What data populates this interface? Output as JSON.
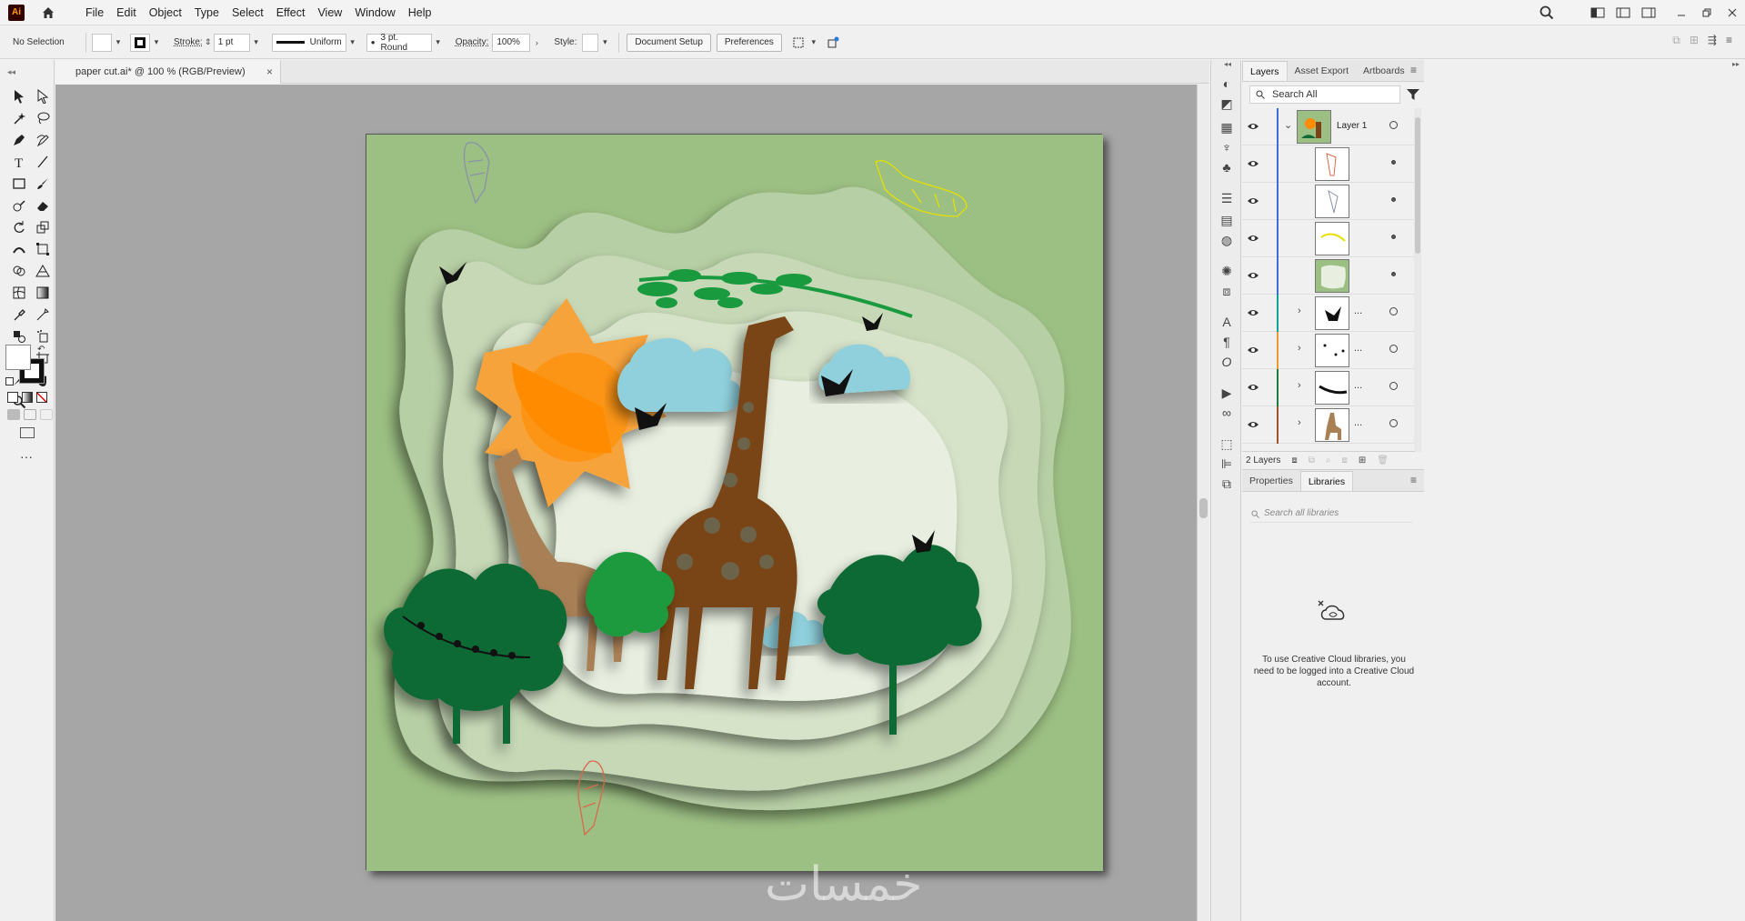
{
  "app": {
    "logo": "Ai"
  },
  "menu": {
    "items": [
      "File",
      "Edit",
      "Object",
      "Type",
      "Select",
      "Effect",
      "View",
      "Window",
      "Help"
    ]
  },
  "control_bar": {
    "selection": "No Selection",
    "stroke_label": "Stroke:",
    "stroke_value": "1 pt",
    "profile": "Uniform",
    "brush": "3 pt. Round",
    "opacity_label": "Opacity:",
    "opacity_value": "100%",
    "style_label": "Style:",
    "document_setup": "Document Setup",
    "preferences": "Preferences"
  },
  "document": {
    "tab_title": "paper cut.ai* @ 100 % (RGB/Preview)",
    "close": "×"
  },
  "layers_panel": {
    "tabs": [
      "Layers",
      "Asset Export",
      "Artboards"
    ],
    "search_placeholder": "Search All",
    "layer_name": "Layer 1",
    "footer_count": "2 Layers",
    "dots": "...",
    "row_colors": [
      "#3d6bd9",
      "#3d6bd9",
      "#3d6bd9",
      "#3d6bd9",
      "#3d6bd9",
      "#0fa19a",
      "#e89a2c",
      "#1f7a3f",
      "#a0522d"
    ]
  },
  "lib_panel": {
    "tabs": [
      "Properties",
      "Libraries"
    ],
    "search_placeholder": "Search all libraries",
    "message": "To use Creative Cloud libraries, you need to be logged into a Creative Cloud account."
  },
  "watermark": "خمسات",
  "colors": {
    "artboard": "#9cbf83",
    "sun": "#ff8c00",
    "sky": "#8fd0dc",
    "giraffe_big": "#7a4418",
    "giraffe_small": "#a97f55",
    "tree": "#0f6b35"
  }
}
